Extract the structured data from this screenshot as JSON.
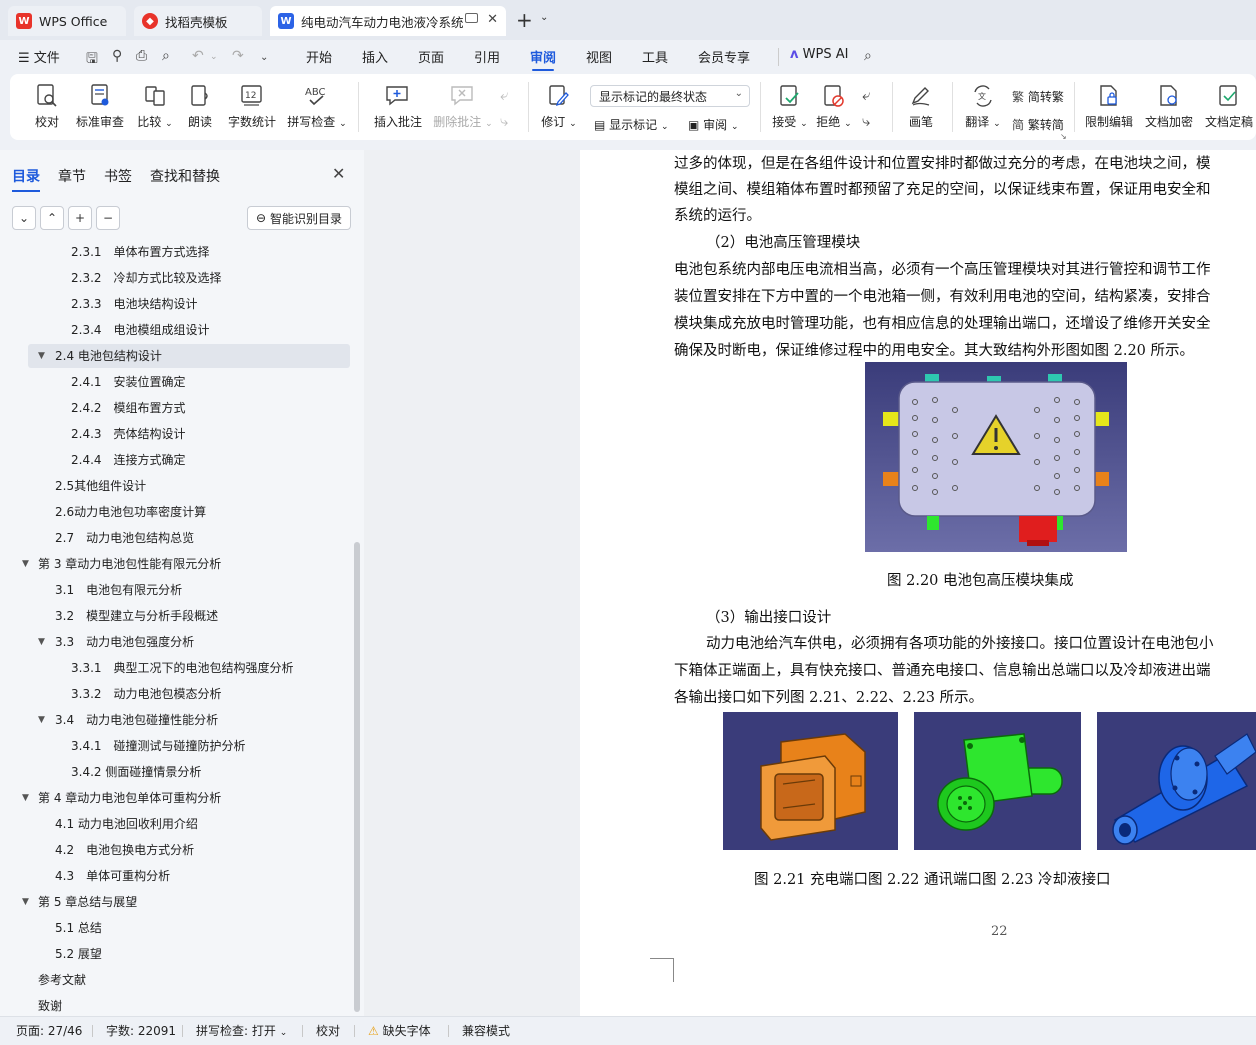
{
  "tabs": [
    {
      "label": "WPS Office"
    },
    {
      "label": "找稻壳模板"
    },
    {
      "label": "纯电动汽车动力电池液冷系统"
    }
  ],
  "menu": {
    "file": "文件",
    "items": [
      "开始",
      "插入",
      "页面",
      "引用",
      "审阅",
      "视图",
      "工具",
      "会员专享"
    ],
    "active": "审阅",
    "ai": "WPS AI"
  },
  "ribbon": {
    "proofread": "校对",
    "standard_review": "标准审查",
    "compare": "比较",
    "read_aloud": "朗读",
    "word_count": "字数统计",
    "spell_check": "拼写检查",
    "insert_comment": "插入批注",
    "delete_comment": "删除批注",
    "track_changes": "修订",
    "display_mode": "显示标记的最终状态",
    "show_markup": "显示标记",
    "review": "审阅",
    "accept": "接受",
    "reject": "拒绝",
    "pen": "画笔",
    "translate": "翻译",
    "simp_to_trad": "简转繁",
    "trad_to_simp": "繁转简",
    "restrict_edit": "限制编辑",
    "encrypt": "文档加密",
    "finalize": "文档定稿"
  },
  "panel": {
    "tabs": [
      "目录",
      "章节",
      "书签",
      "查找和替换"
    ],
    "smart_toc": "智能识别目录",
    "toc": [
      {
        "text": "2.3.1　单体布置方式选择",
        "level": 3,
        "toggle": ""
      },
      {
        "text": "2.3.2　冷却方式比较及选择",
        "level": 3,
        "toggle": ""
      },
      {
        "text": "2.3.3　电池块结构设计",
        "level": 3,
        "toggle": ""
      },
      {
        "text": "2.3.4　电池模组成组设计",
        "level": 3,
        "toggle": ""
      },
      {
        "text": "2.4 电池包结构设计",
        "level": 2,
        "toggle": "▼",
        "highlight": true
      },
      {
        "text": "2.4.1　安装位置确定",
        "level": 3,
        "toggle": ""
      },
      {
        "text": "2.4.2　模组布置方式",
        "level": 3,
        "toggle": ""
      },
      {
        "text": "2.4.3　壳体结构设计",
        "level": 3,
        "toggle": ""
      },
      {
        "text": "2.4.4　连接方式确定",
        "level": 3,
        "toggle": ""
      },
      {
        "text": "2.5其他组件设计",
        "level": 2,
        "toggle": ""
      },
      {
        "text": "2.6动力电池包功率密度计算",
        "level": 2,
        "toggle": ""
      },
      {
        "text": "2.7　动力电池包结构总览",
        "level": 2,
        "toggle": ""
      },
      {
        "text": "第 3 章动力电池包性能有限元分析",
        "level": 1,
        "toggle": "▼"
      },
      {
        "text": "3.1　电池包有限元分析",
        "level": 2,
        "toggle": ""
      },
      {
        "text": "3.2　模型建立与分析手段概述",
        "level": 2,
        "toggle": ""
      },
      {
        "text": "3.3　动力电池包强度分析",
        "level": 2,
        "toggle": "▼"
      },
      {
        "text": "3.3.1　典型工况下的电池包结构强度分析",
        "level": 3,
        "toggle": ""
      },
      {
        "text": "3.3.2　动力电池包模态分析",
        "level": 3,
        "toggle": ""
      },
      {
        "text": "3.4　动力电池包碰撞性能分析",
        "level": 2,
        "toggle": "▼"
      },
      {
        "text": "3.4.1　碰撞测试与碰撞防护分析",
        "level": 3,
        "toggle": ""
      },
      {
        "text": "3.4.2 侧面碰撞情景分析",
        "level": 3,
        "toggle": ""
      },
      {
        "text": "第 4 章动力电池包单体可重构分析",
        "level": 1,
        "toggle": "▼"
      },
      {
        "text": "4.1 动力电池回收利用介绍",
        "level": 2,
        "toggle": ""
      },
      {
        "text": "4.2　电池包换电方式分析",
        "level": 2,
        "toggle": ""
      },
      {
        "text": "4.3　单体可重构分析",
        "level": 2,
        "toggle": ""
      },
      {
        "text": "第 5 章总结与展望",
        "level": 1,
        "toggle": "▼"
      },
      {
        "text": "5.1 总结",
        "level": 2,
        "toggle": ""
      },
      {
        "text": "5.2 展望",
        "level": 2,
        "toggle": ""
      },
      {
        "text": "参考文献",
        "level": 1,
        "toggle": ""
      },
      {
        "text": "致谢",
        "level": 1,
        "toggle": ""
      }
    ]
  },
  "document": {
    "lines_top": [
      "过多的体现，但是在各组件设计和位置安排时都做过充分的考虑，在电池块之间，模",
      "模组之间、模组箱体布置时都预留了充足的空间，以保证线束布置，保证用电安全和",
      "系统的运行。"
    ],
    "heading2": "（2）电池高压管理模块",
    "lines_mid": [
      "电池包系统内部电压电流相当高，必须有一个高压管理模块对其进行管控和调节工作",
      "装位置安排在下方中置的一个电池箱一侧，有效利用电池的空间，结构紧凑，安排合",
      "模块集成充放电时管理功能，也有相应信息的处理输出端口，还增设了维修开关安全",
      "确保及时断电，保证维修过程中的用电安全。其大致结构外形图如图 2.20 所示。"
    ],
    "fig220_caption": "图 2.20 电池包高压模块集成",
    "heading3": "（3）输出接口设计",
    "lines_bot": [
      "动力电池给汽车供电，必须拥有各项功能的外接接口。接口位置设计在电池包小",
      "下箱体正端面上，具有快充接口、普通充电接口、信息输出总端口以及冷却液进出端",
      "各输出接口如下列图 2.21、2.22、2.23 所示。"
    ],
    "fig221_caption": "图 2.21 充电端口图 2.22 通讯端口图 2.23 冷却液接口",
    "page_number": "22"
  },
  "status": {
    "page": "页面: 27/46",
    "words": "字数: 22091",
    "spell": "拼写检查: 打开",
    "proof": "校对",
    "missing_font": "缺失字体",
    "compat": "兼容模式"
  },
  "colors": {
    "accent": "#1e5adc",
    "cad_bg": "#3a3c7a",
    "module_body": "#c8c8e6",
    "orange": "#e8821a",
    "green": "#2ee62e",
    "blue": "#1e66e8"
  }
}
